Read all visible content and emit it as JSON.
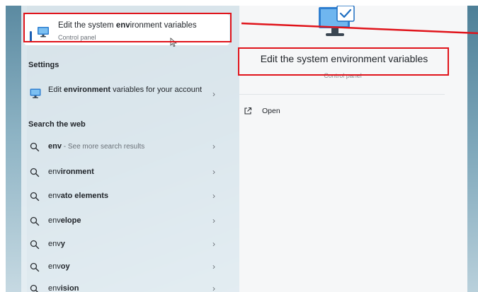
{
  "best_match": {
    "title_before": "Edit the system ",
    "title_bold": "env",
    "title_after": "ironment variables",
    "subtitle": "Control panel"
  },
  "sections": {
    "settings": "Settings",
    "search_web": "Search the web"
  },
  "settings_item": {
    "prefix": "Edit ",
    "bold": "environment",
    "suffix": " variables for your account"
  },
  "web_results": [
    {
      "bold": "env",
      "muted": " - See more search results"
    },
    {
      "prefix": "env",
      "bold": "ironment"
    },
    {
      "prefix": "env",
      "bold": "ato elements"
    },
    {
      "prefix": "env",
      "bold": "elope"
    },
    {
      "prefix": "env",
      "bold": "y"
    },
    {
      "prefix": "env",
      "bold": "oy"
    },
    {
      "prefix": "env",
      "bold": "ision"
    }
  ],
  "detail": {
    "title": "Edit the system environment variables",
    "subtitle": "Control panel",
    "open_label": "Open"
  },
  "icons": {
    "best_match": "monitor-icon",
    "settings_item": "monitor-icon",
    "web_result": "search-icon",
    "chevron": "chevron-right-icon",
    "open": "open-external-icon",
    "cursor": "mouse-cursor-icon"
  },
  "colors": {
    "accent": "#1a5fb4",
    "annotation": "#e0141b"
  }
}
